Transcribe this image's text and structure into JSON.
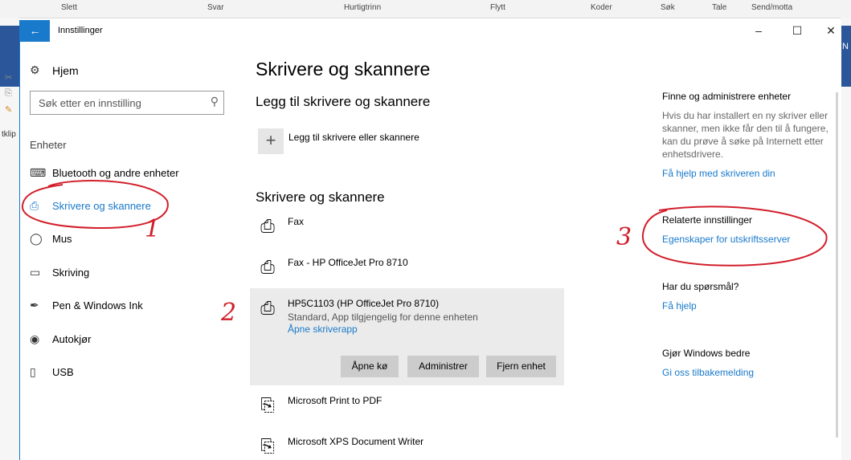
{
  "ribbon": [
    "Slett",
    "Svar",
    "Hurtigtrinn",
    "Flytt",
    "Koder",
    "Søk",
    "Tale",
    "Send/motta"
  ],
  "outlook": {
    "left_label": "tklip",
    "right_label": "N"
  },
  "window": {
    "title": "Innstillinger",
    "controls": {
      "minimize": "–",
      "maximize": "☐",
      "close": "✕"
    }
  },
  "sidebar": {
    "home": "Hjem",
    "search_placeholder": "Søk etter en innstilling",
    "section": "Enheter",
    "items": [
      {
        "label": "Bluetooth og andre enheter",
        "icon": "bluetooth-devices-icon",
        "active": false
      },
      {
        "label": "Skrivere og skannere",
        "icon": "printer-icon",
        "active": true
      },
      {
        "label": "Mus",
        "icon": "mouse-icon",
        "active": false
      },
      {
        "label": "Skriving",
        "icon": "keyboard-icon",
        "active": false
      },
      {
        "label": "Pen & Windows Ink",
        "icon": "pen-icon",
        "active": false
      },
      {
        "label": "Autokjør",
        "icon": "autoplay-icon",
        "active": false
      },
      {
        "label": "USB",
        "icon": "usb-icon",
        "active": false
      }
    ]
  },
  "main": {
    "title": "Skrivere og skannere",
    "add_section": "Legg til skrivere og skannere",
    "add_button": "Legg til skrivere eller skannere",
    "list_section": "Skrivere og skannere",
    "printers": [
      {
        "name": "Fax",
        "icon": "printer-icon"
      },
      {
        "name": "Fax - HP OfficeJet Pro 8710",
        "icon": "printer-icon"
      },
      {
        "name": "HP5C1103 (HP OfficeJet Pro 8710)",
        "status": "Standard, App tilgjengelig for denne enheten",
        "link": "Åpne skriverapp",
        "icon": "printer-icon",
        "selected": true
      },
      {
        "name": "Microsoft Print to PDF",
        "icon": "pdf-printer-icon"
      },
      {
        "name": "Microsoft XPS Document Writer",
        "icon": "document-printer-icon"
      }
    ],
    "buttons": {
      "open_queue": "Åpne kø",
      "manage": "Administrer",
      "remove": "Fjern enhet"
    }
  },
  "side": {
    "find_heading": "Finne og administrere enheter",
    "find_text": "Hvis du har installert en ny skriver eller skanner, men ikke får den til å fungere, kan du prøve å søke på Internett etter enhetsdrivere.",
    "find_link": "Få hjelp med skriveren din",
    "related_heading": "Relaterte innstillinger",
    "related_link": "Egenskaper for utskriftsserver",
    "questions_heading": "Har du spørsmål?",
    "questions_link": "Få hjelp",
    "feedback_heading": "Gjør Windows bedre",
    "feedback_link": "Gi oss tilbakemelding"
  },
  "annotations": {
    "one": "1",
    "two": "2",
    "three": "3"
  },
  "colors": {
    "accent": "#1979ca",
    "annotation": "#d21f2b",
    "selected_bg": "#ebebeb"
  }
}
